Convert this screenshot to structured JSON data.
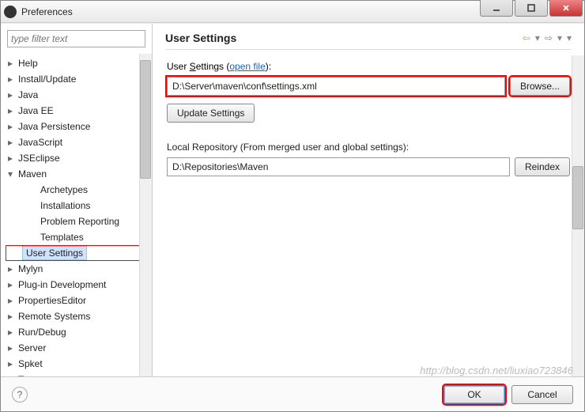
{
  "window": {
    "title": "Preferences"
  },
  "filter": {
    "placeholder": "type filter text"
  },
  "tree": {
    "items": [
      {
        "label": "Help",
        "exp": false,
        "level": 0
      },
      {
        "label": "Install/Update",
        "exp": false,
        "level": 0
      },
      {
        "label": "Java",
        "exp": false,
        "level": 0
      },
      {
        "label": "Java EE",
        "exp": false,
        "level": 0
      },
      {
        "label": "Java Persistence",
        "exp": false,
        "level": 0
      },
      {
        "label": "JavaScript",
        "exp": false,
        "level": 0
      },
      {
        "label": "JSEclipse",
        "exp": false,
        "level": 0
      },
      {
        "label": "Maven",
        "exp": true,
        "level": 0
      },
      {
        "label": "Archetypes",
        "exp": null,
        "level": 1
      },
      {
        "label": "Installations",
        "exp": null,
        "level": 1
      },
      {
        "label": "Problem Reporting",
        "exp": null,
        "level": 1
      },
      {
        "label": "Templates",
        "exp": null,
        "level": 1
      },
      {
        "label": "User Settings",
        "exp": null,
        "level": 1,
        "selected": true
      },
      {
        "label": "Mylyn",
        "exp": false,
        "level": 0
      },
      {
        "label": "Plug-in Development",
        "exp": false,
        "level": 0
      },
      {
        "label": "PropertiesEditor",
        "exp": false,
        "level": 0
      },
      {
        "label": "Remote Systems",
        "exp": false,
        "level": 0
      },
      {
        "label": "Run/Debug",
        "exp": false,
        "level": 0
      },
      {
        "label": "Server",
        "exp": false,
        "level": 0
      },
      {
        "label": "Spket",
        "exp": false,
        "level": 0
      },
      {
        "label": "Team",
        "exp": false,
        "level": 0
      }
    ]
  },
  "page": {
    "heading": "User Settings",
    "user_settings_label_pre": "User ",
    "user_settings_label_u": "S",
    "user_settings_label_post": "ettings (",
    "open_file": "open file",
    "user_settings_label_close": "):",
    "path_value": "D:\\Server\\maven\\conf\\settings.xml",
    "browse": "Browse...",
    "update": "Update Settings",
    "local_label": "Local Repository (From merged user and global settings):",
    "local_value": "D:\\Repositories\\Maven",
    "reindex": "Reindex"
  },
  "footer": {
    "ok": "OK",
    "cancel": "Cancel"
  },
  "watermark": "http://blog.csdn.net/liuxiao723846"
}
